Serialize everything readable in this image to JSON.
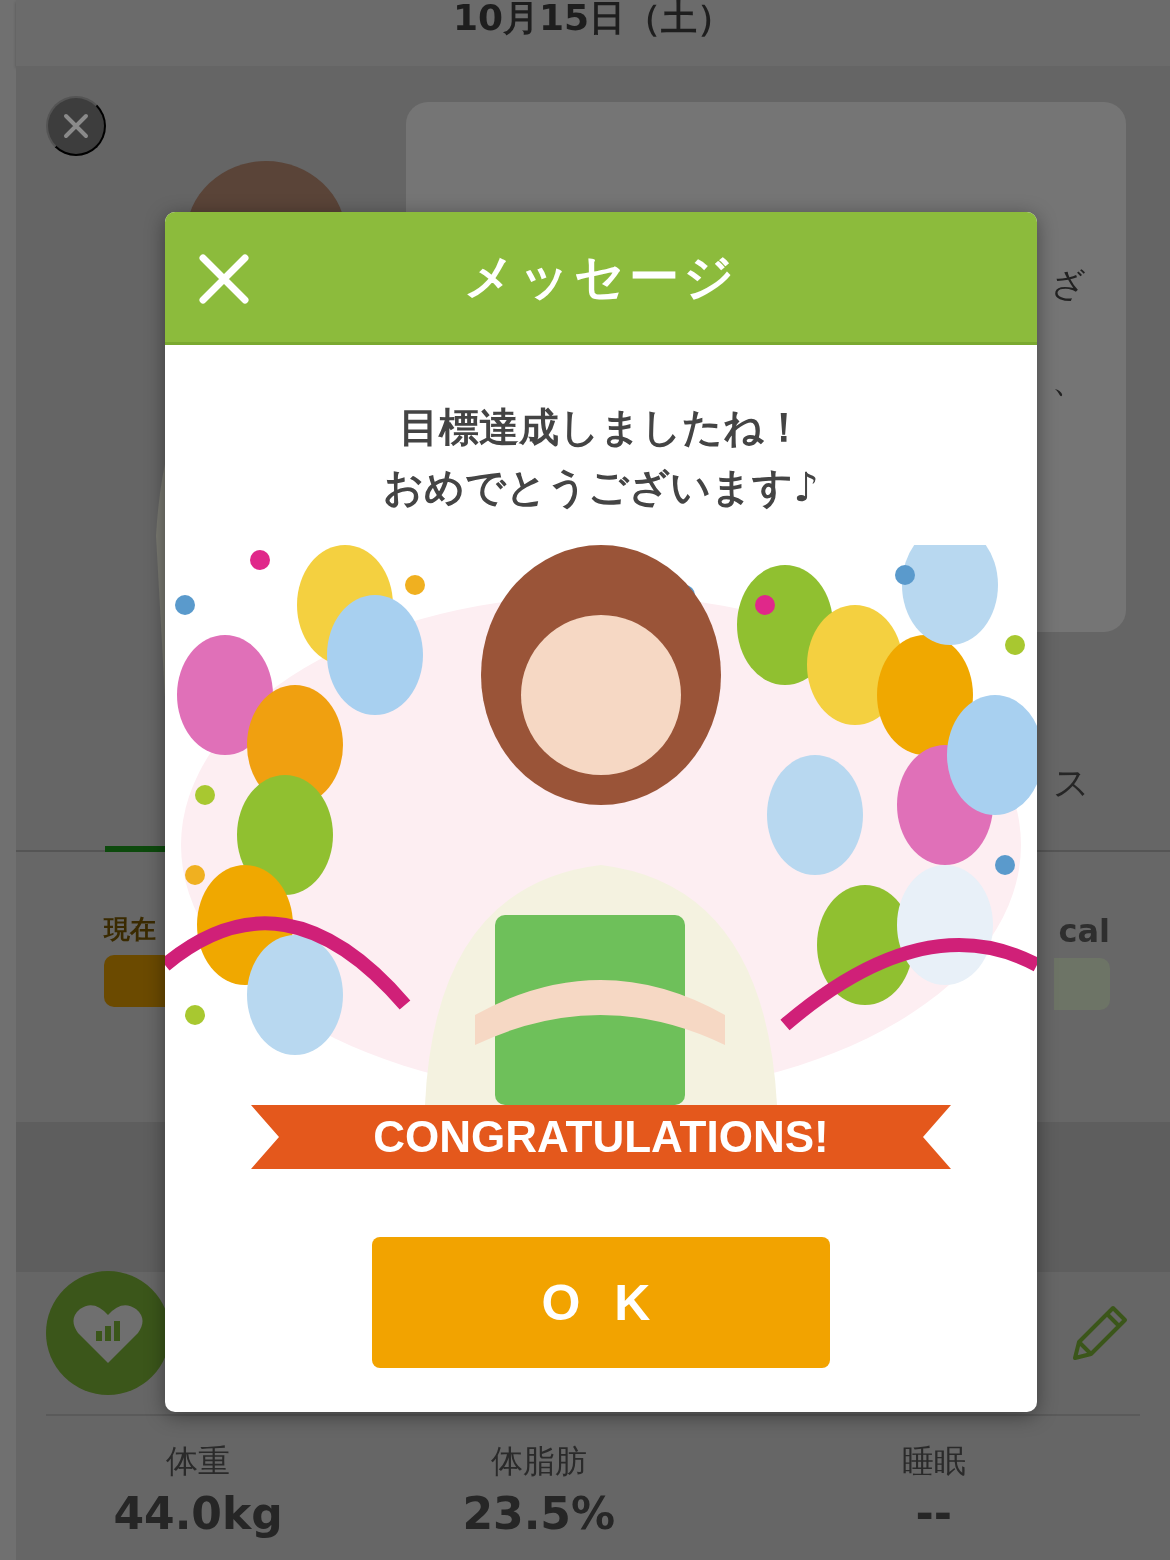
{
  "header": {
    "date": "10月15日（土）"
  },
  "speech_fragments": [
    "ざ",
    "、"
  ],
  "tabs": [
    {
      "selected": true
    },
    {
      "label": "ス",
      "selected": false
    }
  ],
  "meters": [
    {
      "label": "現在",
      "color": "#6b4a00"
    },
    {
      "label": "cal",
      "color": "#6d7466"
    }
  ],
  "stats": [
    {
      "label": "体重",
      "value": "44.0kg"
    },
    {
      "label": "体脂肪",
      "value": "23.5%"
    },
    {
      "label": "睡眠",
      "value": "--"
    }
  ],
  "dialog": {
    "title": "メッセージ",
    "message": [
      "目標達成しましたね！",
      "おめでとうございます♪"
    ],
    "banner": "CONGRATULATIONS!",
    "button": "O K"
  }
}
